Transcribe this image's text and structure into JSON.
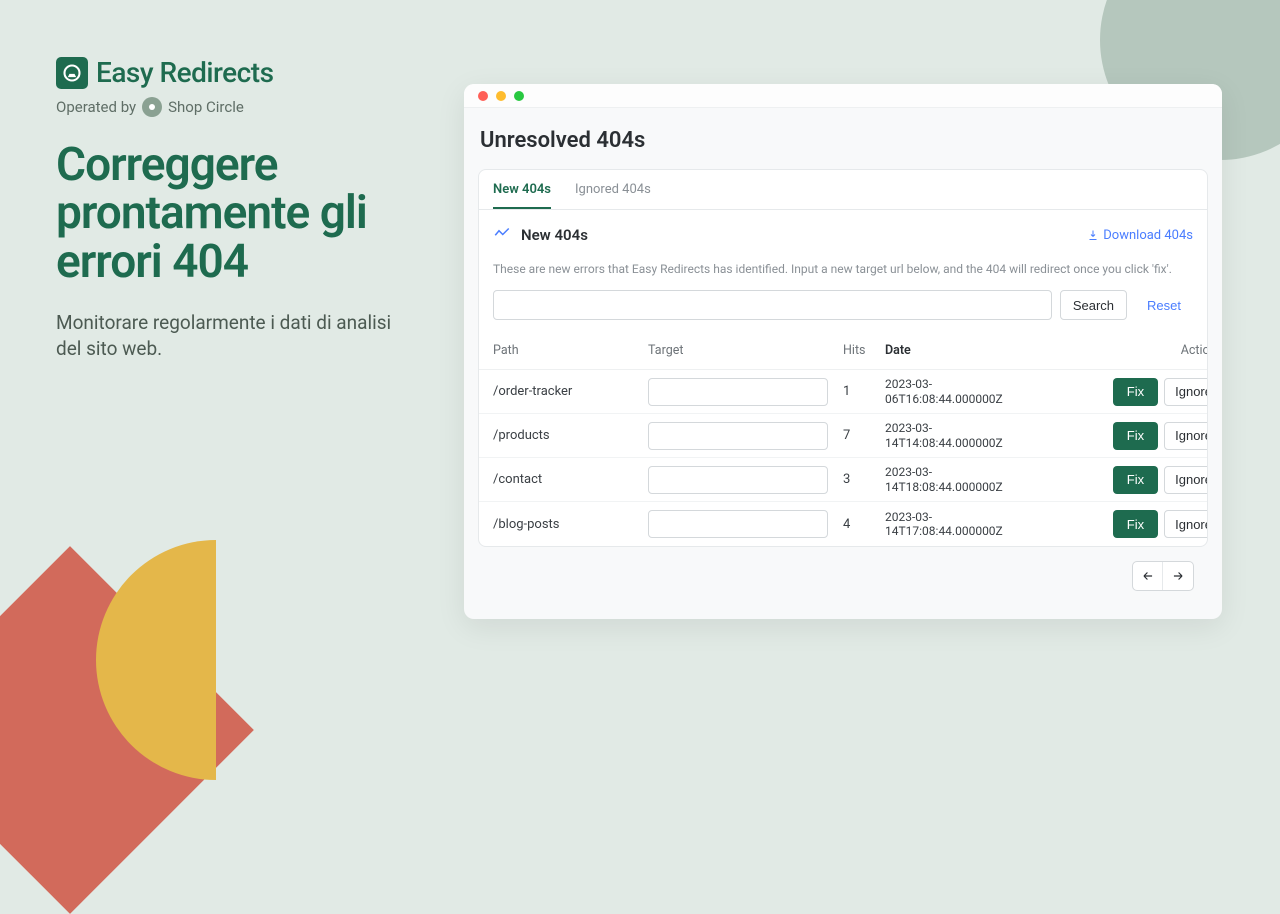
{
  "brand": {
    "name": "Easy Redirects",
    "operated_prefix": "Operated by",
    "operated_by": "Shop Circle"
  },
  "marketing": {
    "headline": "Correggere prontamente gli errori 404",
    "subtext": "Monitorare regolarmente i dati di analisi del sito web."
  },
  "app": {
    "title": "Unresolved 404s",
    "tabs": [
      {
        "label": "New 404s",
        "active": true
      },
      {
        "label": "Ignored 404s",
        "active": false
      }
    ],
    "section_title": "New 404s",
    "download_label": "Download 404s",
    "description": "These are new errors that Easy Redirects has identified. Input a new target url below, and the 404 will redirect once you click 'fix'.",
    "search": {
      "button": "Search",
      "reset": "Reset"
    },
    "columns": {
      "path": "Path",
      "target": "Target",
      "hits": "Hits",
      "date": "Date",
      "actions": "Actions"
    },
    "actions": {
      "fix": "Fix",
      "ignore": "Ignore"
    },
    "rows": [
      {
        "path": "/order-tracker",
        "hits": "1",
        "date1": "2023-03-",
        "date2": "06T16:08:44.000000Z"
      },
      {
        "path": "/products",
        "hits": "7",
        "date1": "2023-03-",
        "date2": "14T14:08:44.000000Z"
      },
      {
        "path": "/contact",
        "hits": "3",
        "date1": "2023-03-",
        "date2": "14T18:08:44.000000Z"
      },
      {
        "path": "/blog-posts",
        "hits": "4",
        "date1": "2023-03-",
        "date2": "14T17:08:44.000000Z"
      }
    ]
  }
}
